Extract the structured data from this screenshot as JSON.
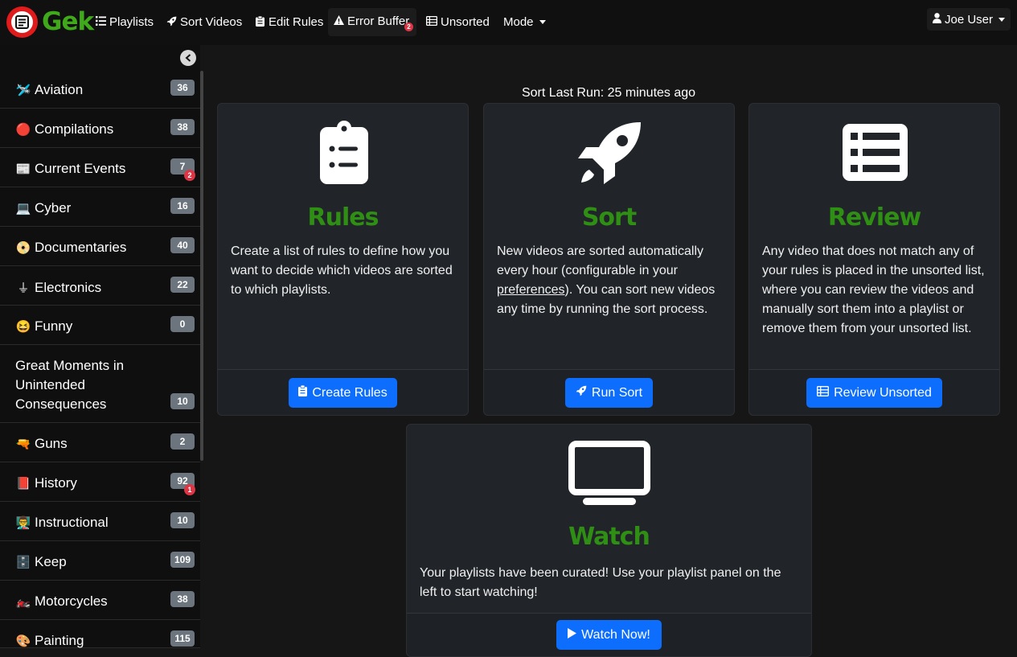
{
  "brand": {
    "name": "Gek"
  },
  "nav": {
    "playlists": "Playlists",
    "sort_videos": "Sort Videos",
    "edit_rules": "Edit Rules",
    "error_buffer": "Error Buffer",
    "error_count": "2",
    "unsorted": "Unsorted",
    "mode": "Mode",
    "user": "Joe User"
  },
  "sidebar": {
    "items": [
      {
        "emoji": "🛩️",
        "label": "Aviation",
        "count": "36"
      },
      {
        "emoji": "🔴",
        "label": "Compilations",
        "count": "38"
      },
      {
        "emoji": "📰",
        "label": "Current Events",
        "count": "7",
        "alert": "2"
      },
      {
        "emoji": "💻",
        "label": "Cyber",
        "count": "16"
      },
      {
        "emoji": "📀",
        "label": "Documentaries",
        "count": "40"
      },
      {
        "emoji": "⏚",
        "label": "Electronics",
        "count": "22"
      },
      {
        "emoji": "😆",
        "label": "Funny",
        "count": "0"
      },
      {
        "emoji": "",
        "label": "Great Moments in Unintended Consequences",
        "count": "10"
      },
      {
        "emoji": "🔫",
        "label": "Guns",
        "count": "2"
      },
      {
        "emoji": "📕",
        "label": "History",
        "count": "92",
        "alert": "1"
      },
      {
        "emoji": "👨‍🏫",
        "label": "Instructional",
        "count": "10"
      },
      {
        "emoji": "🗄️",
        "label": "Keep",
        "count": "109"
      },
      {
        "emoji": "🏍️",
        "label": "Motorcycles",
        "count": "38"
      },
      {
        "emoji": "🎨",
        "label": "Painting",
        "count": "115"
      }
    ]
  },
  "main": {
    "sort_status": "Sort Last Run: 25 minutes ago",
    "cards": {
      "rules": {
        "title": "Rules",
        "text": "Create a list of rules to define how you want to decide which videos are sorted to which playlists.",
        "button": "Create Rules"
      },
      "sort": {
        "title": "Sort",
        "text_before": "New videos are sorted automatically every hour (configurable in your ",
        "link": "preferences",
        "text_after": "). You can sort new videos any time by running the sort process.",
        "button": "Run Sort"
      },
      "review": {
        "title": "Review",
        "text": "Any video that does not match any of your rules is placed in the unsorted list, where you can review the videos and manually sort them into a playlist or remove them from your unsorted list.",
        "button": "Review Unsorted"
      },
      "watch": {
        "title": "Watch",
        "text": "Your playlists have been curated! Use your playlist panel on the left to start watching!",
        "button": "Watch Now!"
      }
    }
  },
  "colors": {
    "accent": "#0d6efd",
    "brand_green": "#3fa91b",
    "logo_red": "#e01b1b",
    "badge_red": "#dc3545"
  }
}
